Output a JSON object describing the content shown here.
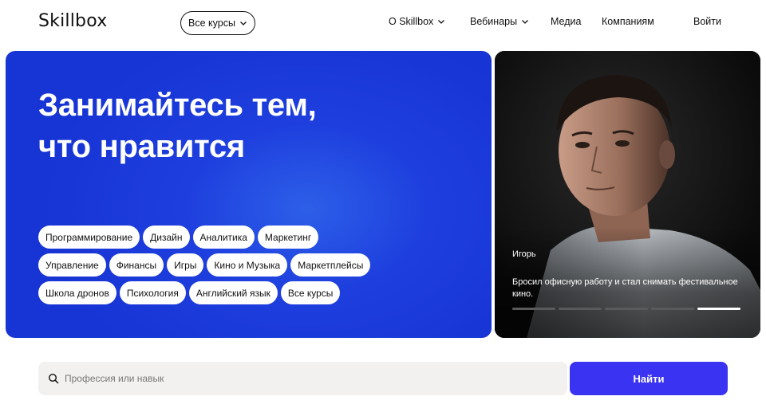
{
  "header": {
    "logo": "Skillbox",
    "courses_button": "Все курсы",
    "nav": [
      {
        "label": "О Skillbox",
        "has_dropdown": true
      },
      {
        "label": "Вебинары",
        "has_dropdown": true
      },
      {
        "label": "Медиа",
        "has_dropdown": false
      },
      {
        "label": "Компаниям",
        "has_dropdown": false
      }
    ],
    "login": "Войти"
  },
  "hero": {
    "title_line1": "Занимайтесь тем,",
    "title_line2": "что нравится",
    "chips": [
      [
        "Программирование",
        "Дизайн",
        "Аналитика",
        "Маркетинг"
      ],
      [
        "Управление",
        "Финансы",
        "Игры",
        "Кино и Музыка",
        "Маркетплейсы"
      ],
      [
        "Школа дронов",
        "Психология",
        "Английский язык",
        "Все курсы"
      ]
    ]
  },
  "story": {
    "name": "Игорь",
    "quote": "Бросил офисную работу и стал снимать фестивальное кино.",
    "segments": 5,
    "active_segment": 5
  },
  "search": {
    "placeholder": "Профессия или навык",
    "value": "",
    "button": "Найти"
  },
  "colors": {
    "hero_blue": "#1e3fde",
    "button_blue": "#3a33f2",
    "search_bg": "#f2f1ef"
  }
}
